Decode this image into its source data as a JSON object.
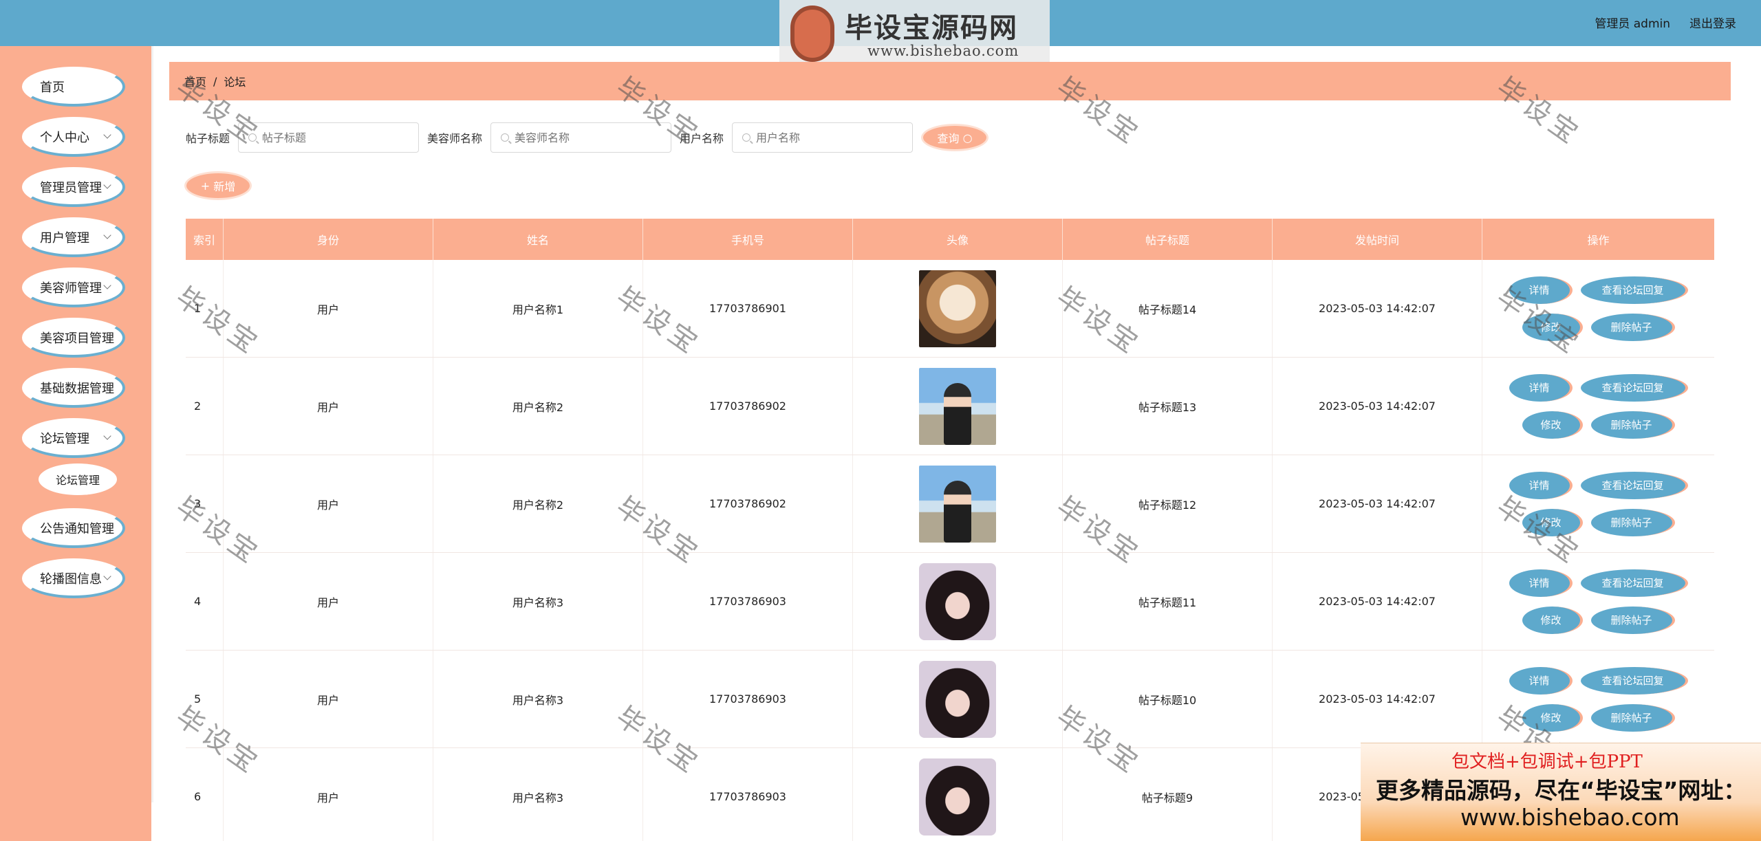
{
  "header": {
    "logo_title": "毕设宝源码网",
    "logo_url": "www.bishebao.com",
    "user_label": "管理员 admin",
    "logout": "退出登录"
  },
  "sidebar": {
    "items": [
      {
        "label": "首页"
      },
      {
        "label": "个人中心"
      },
      {
        "label": "管理员管理"
      },
      {
        "label": "用户管理"
      },
      {
        "label": "美容师管理"
      },
      {
        "label": "美容项目管理"
      },
      {
        "label": "基础数据管理"
      },
      {
        "label": "论坛管理"
      },
      {
        "label": "论坛管理"
      },
      {
        "label": "公告通知管理"
      },
      {
        "label": "轮播图信息"
      }
    ]
  },
  "breadcrumb": {
    "home": "首页",
    "sep": "/",
    "current": "论坛"
  },
  "search": {
    "title_label": "帖子标题",
    "title_placeholder": "帖子标题",
    "beautician_label": "美容师名称",
    "beautician_placeholder": "美容师名称",
    "user_label": "用户名称",
    "user_placeholder": "用户名称",
    "query_button": "查询"
  },
  "add_button": "新增",
  "table": {
    "headers": [
      "索引",
      "身份",
      "姓名",
      "手机号",
      "头像",
      "帖子标题",
      "发帖时间",
      "操作"
    ],
    "rows": [
      {
        "index": "1",
        "role": "用户",
        "name": "用户名称1",
        "phone": "17703786901",
        "title": "帖子标题14",
        "time": "2023-05-03 14:42:07"
      },
      {
        "index": "2",
        "role": "用户",
        "name": "用户名称2",
        "phone": "17703786902",
        "title": "帖子标题13",
        "time": "2023-05-03 14:42:07"
      },
      {
        "index": "3",
        "role": "用户",
        "name": "用户名称2",
        "phone": "17703786902",
        "title": "帖子标题12",
        "time": "2023-05-03 14:42:07"
      },
      {
        "index": "4",
        "role": "用户",
        "name": "用户名称3",
        "phone": "17703786903",
        "title": "帖子标题11",
        "time": "2023-05-03 14:42:07"
      },
      {
        "index": "5",
        "role": "用户",
        "name": "用户名称3",
        "phone": "17703786903",
        "title": "帖子标题10",
        "time": "2023-05-03 14:42:07"
      },
      {
        "index": "6",
        "role": "用户",
        "name": "用户名称3",
        "phone": "17703786903",
        "title": "帖子标题9",
        "time": "2023-05-03 14:42:07"
      }
    ],
    "ops": {
      "detail": "详情",
      "view_replies": "查看论坛回复",
      "edit": "修改",
      "delete": "删除帖子"
    }
  },
  "watermark": "毕设宝",
  "ad": {
    "line1": "包文档+包调试+包PPT",
    "line2": "更多精品源码，尽在“毕设宝”网址：",
    "line3": "www.bishebao.com"
  },
  "colors": {
    "topbar": "#5ea9cc",
    "accent": "#fbae90",
    "button_blue": "#5ea9cc"
  }
}
